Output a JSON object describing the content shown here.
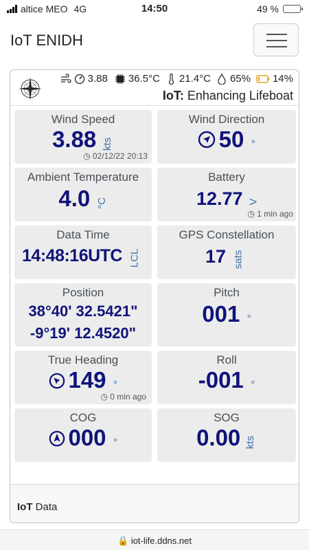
{
  "status": {
    "carrier": "altice MEO",
    "network": "4G",
    "time": "14:50",
    "battery": "49 %",
    "battery_level": 0.49
  },
  "navbar": {
    "brand": "IoT ENIDH"
  },
  "header": {
    "wind": "3.88",
    "cpu_temp": "36.5°C",
    "ambient_temp": "21.4°C",
    "humidity": "65%",
    "battery": "14%",
    "title_bold": "IoT:",
    "title_rest": " Enhancing Lifeboat"
  },
  "tiles": {
    "wind_speed": {
      "label": "Wind Speed",
      "value": "3.88",
      "unit": "kts",
      "timestamp": "02/12/22 20:13"
    },
    "wind_direction": {
      "label": "Wind Direction",
      "value": "50",
      "unit": "°"
    },
    "ambient_temperature": {
      "label": "Ambient Temperature",
      "value": "4.0",
      "unit": "°C"
    },
    "battery": {
      "label": "Battery",
      "value": "12.77",
      "unit": "V",
      "ago": "1 min ago"
    },
    "data_time": {
      "label": "Data Time",
      "value": "14:48:16UTC",
      "unit": "LCL"
    },
    "gps": {
      "label": "GPS Constellation",
      "value": "17",
      "unit": "sats"
    },
    "position": {
      "label": "Position",
      "lat": "38°40' 32.5421\"",
      "lon": "-9°19' 12.4520\""
    },
    "pitch": {
      "label": "Pitch",
      "value": "001",
      "unit": "°"
    },
    "true_heading": {
      "label": "True Heading",
      "value": "149",
      "unit": "°",
      "ago": "0 min ago"
    },
    "roll": {
      "label": "Roll",
      "value": "-001",
      "unit": "°"
    },
    "cog": {
      "label": "COG",
      "value": "000",
      "unit": "°"
    },
    "sog": {
      "label": "SOG",
      "value": "0.00",
      "unit": "kts"
    }
  },
  "footer": {
    "bold": "IoT",
    "rest": " Data"
  },
  "urlbar": {
    "url": "iot-life.ddns.net"
  }
}
